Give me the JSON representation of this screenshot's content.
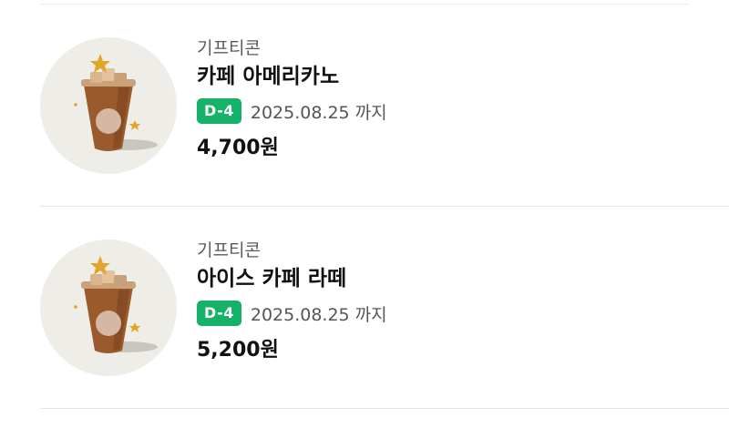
{
  "items": [
    {
      "category": "기프티콘",
      "name": "카페 아메리카노",
      "dday": "D-4",
      "expiry": "2025.08.25 까지",
      "price": "4,700원",
      "image_icon": "iced-coffee-cup-icon"
    },
    {
      "category": "기프티콘",
      "name": "아이스 카페 라떼",
      "dday": "D-4",
      "expiry": "2025.08.25 까지",
      "price": "5,200원",
      "image_icon": "iced-coffee-cup-icon"
    }
  ],
  "colors": {
    "dday_badge": "#17b26a",
    "thumb_bg": "#efede7",
    "cup": "#9a5a2c",
    "star": "#e0a52a"
  }
}
